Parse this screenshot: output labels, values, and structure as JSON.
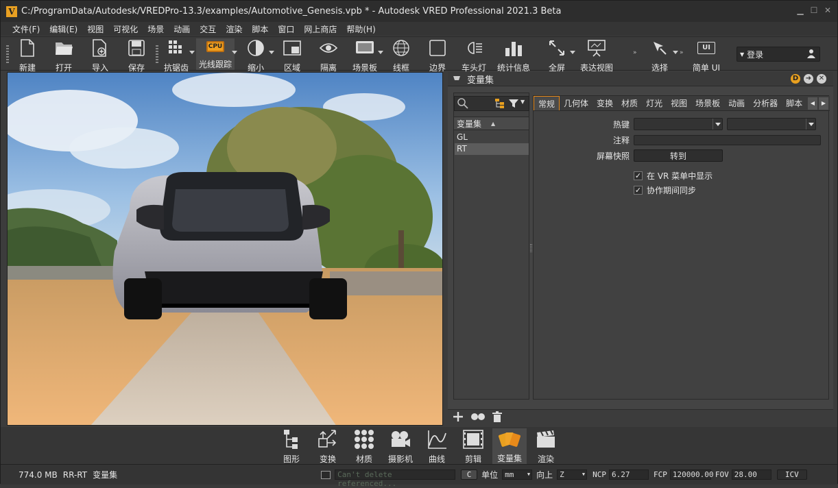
{
  "window": {
    "title": "C:/ProgramData/Autodesk/VREDPro-13.3/examples/Automotive_Genesis.vpb * - Autodesk VRED Professional 2021.3 Beta",
    "logo_letter": "V"
  },
  "menubar": [
    "文件(F)",
    "编辑(E)",
    "视图",
    "可视化",
    "场景",
    "动画",
    "交互",
    "渲染",
    "脚本",
    "窗口",
    "网上商店",
    "帮助(H)"
  ],
  "toolbar": {
    "new": "新建",
    "open": "打开",
    "import": "导入",
    "save": "保存",
    "antialias": "抗锯齿",
    "raytrace": "光线跟踪",
    "raytrace_badge": "CPU",
    "shrink": "缩小",
    "region": "区域",
    "isolate": "隔离",
    "sceneboard": "场景板",
    "wireframe": "线框",
    "border": "边界",
    "headlight": "车头灯",
    "stats": "统计信息",
    "fullscreen": "全屏",
    "presenter": "表达视图",
    "select": "选择",
    "simple_ui": "简单 UI",
    "simple_ui_badge": "UI",
    "login": "登录"
  },
  "panel": {
    "title": "变量集",
    "list_header": "变量集",
    "items": [
      "GL",
      "RT"
    ],
    "selected": "RT",
    "tabs": [
      "常规",
      "几何体",
      "变换",
      "材质",
      "灯光",
      "视图",
      "场景板",
      "动画",
      "分析器",
      "脚本"
    ],
    "active_tab": "常规",
    "hotkey_label": "热键",
    "note_label": "注释",
    "snapshot_label": "屏幕快照",
    "goto_button": "转到",
    "show_vr_label": "在 VR 菜单中显示",
    "show_vr_checked": true,
    "sync_label": "协作期间同步",
    "sync_checked": true
  },
  "dock": [
    "图形",
    "变换",
    "材质",
    "摄影机",
    "曲线",
    "剪辑",
    "变量集",
    "渲染"
  ],
  "dock_active": "变量集",
  "status": {
    "memory": "774.0 MB",
    "mode": "RR-RT",
    "module": "变量集",
    "message": "Can't delete referenced...",
    "c_button": "C",
    "unit_label": "单位",
    "unit_value": "mm",
    "up_label": "向上",
    "up_value": "Z",
    "ncp_label": "NCP",
    "ncp_value": "6.27",
    "fcp_label": "FCP",
    "fcp_value": "120000.00",
    "fov_label": "FOV",
    "fov_value": "28.00",
    "icv_button": "ICV"
  },
  "colors": {
    "accent": "#e88a1a",
    "background": "#3c3c3c",
    "panel": "#444444"
  }
}
